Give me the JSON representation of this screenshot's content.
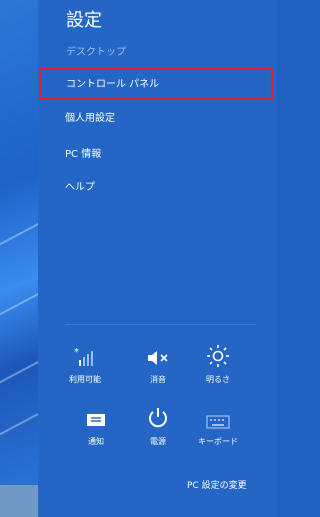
{
  "panel": {
    "title": "設定",
    "subtitle": "デスクトップ",
    "items": [
      {
        "label": "コントロール パネル"
      },
      {
        "label": "個人用設定"
      },
      {
        "label": "PC 情報"
      },
      {
        "label": "ヘルプ"
      }
    ]
  },
  "quick_settings": [
    {
      "label": "利用可能",
      "icon": "network-icon"
    },
    {
      "label": "消音",
      "icon": "volume-muted-icon"
    },
    {
      "label": "明るさ",
      "icon": "brightness-icon"
    },
    {
      "label": "通知",
      "icon": "notifications-icon"
    },
    {
      "label": "電源",
      "icon": "power-icon"
    },
    {
      "label": "キーボード",
      "icon": "keyboard-icon"
    }
  ],
  "footer": {
    "pc_settings_label": "PC 設定の変更"
  },
  "colors": {
    "panel_bg": "#2466c6",
    "highlight_border": "#e0212b",
    "subtitle": "#9fc0ee"
  }
}
